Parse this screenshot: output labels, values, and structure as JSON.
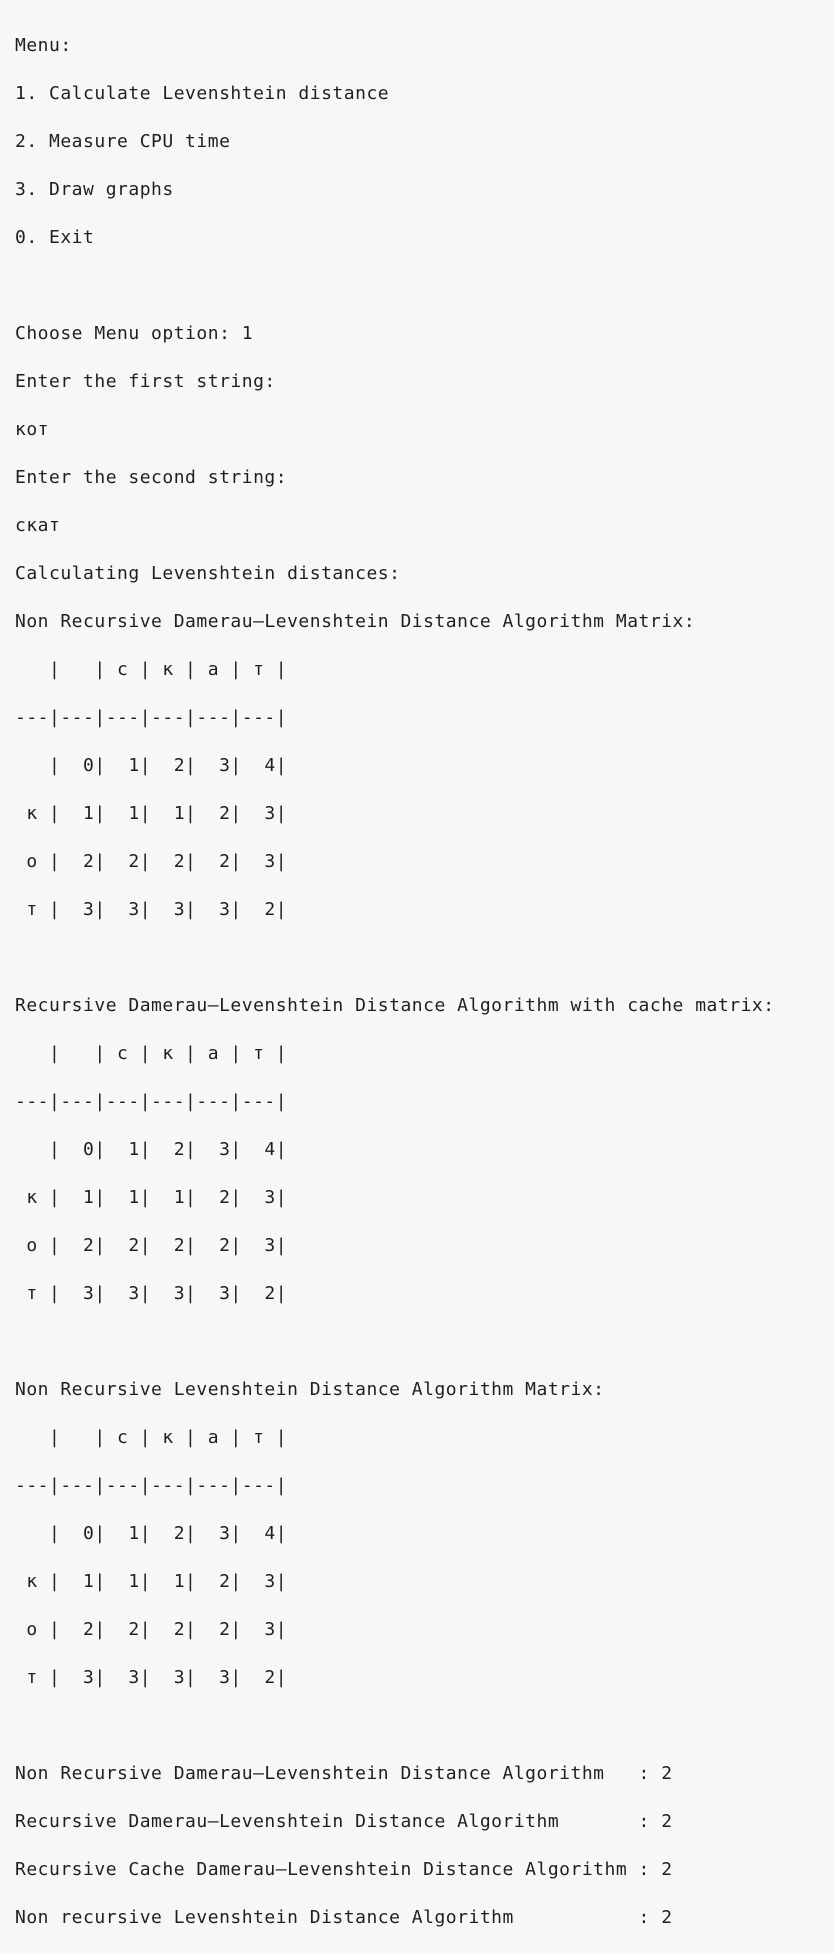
{
  "terminal": {
    "menu_title": "Menu:",
    "menu_items": [
      "1. Calculate Levenshtein distance",
      "2. Measure CPU time",
      "3. Draw graphs",
      "0. Exit"
    ],
    "prompt_choose": "Choose Menu option: 1",
    "prompt_first": "Enter the first string:",
    "input_first": "кот",
    "prompt_second": "Enter the second string:",
    "input_second": "скат",
    "calculating": "Calculating Levenshtein distances:",
    "matrices": [
      {
        "title": "Non Recursive Damerau–Levenshtein Distance Algorithm Matrix:",
        "rows": [
          "   |   | с | к | а | т |",
          "---|---|---|---|---|---|",
          "   |  0|  1|  2|  3|  4|",
          " к |  1|  1|  1|  2|  3|",
          " о |  2|  2|  2|  2|  3|",
          " т |  3|  3|  3|  3|  2|"
        ]
      },
      {
        "title": "Recursive Damerau–Levenshtein Distance Algorithm with cache matrix:",
        "rows": [
          "   |   | с | к | а | т |",
          "---|---|---|---|---|---|",
          "   |  0|  1|  2|  3|  4|",
          " к |  1|  1|  1|  2|  3|",
          " о |  2|  2|  2|  2|  3|",
          " т |  3|  3|  3|  3|  2|"
        ]
      },
      {
        "title": "Non Recursive Levenshtein Distance Algorithm Matrix:",
        "rows": [
          "   |   | с | к | а | т |",
          "---|---|---|---|---|---|",
          "   |  0|  1|  2|  3|  4|",
          " к |  1|  1|  1|  2|  3|",
          " о |  2|  2|  2|  2|  3|",
          " т |  3|  3|  3|  3|  2|"
        ]
      }
    ],
    "results": [
      "Non Recursive Damerau–Levenshtein Distance Algorithm   : 2",
      "Recursive Damerau–Levenshtein Distance Algorithm       : 2",
      "Recursive Cache Damerau–Levenshtein Distance Algorithm : 2",
      "Non recursive Levenshtein Distance Algorithm           : 2"
    ]
  }
}
